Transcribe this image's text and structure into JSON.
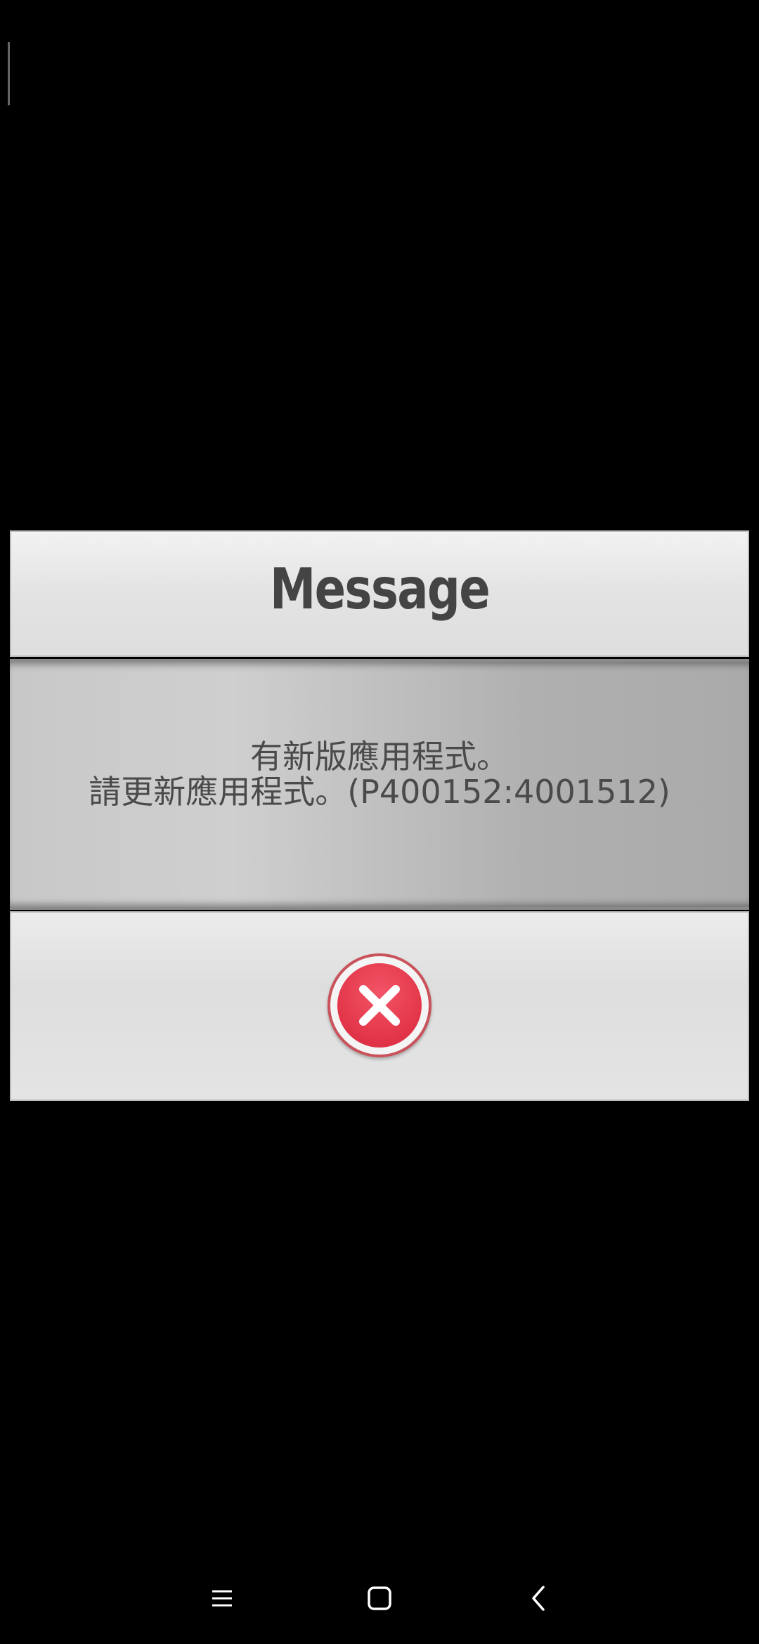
{
  "dialog": {
    "title": "Message",
    "message_lines": [
      "有新版應用程式。",
      "請更新應用程式。(P400152:4001512)"
    ],
    "close_icon": "close-icon"
  },
  "nav_bar": {
    "recents_icon": "recents-icon",
    "home_icon": "home-icon",
    "back_icon": "back-icon"
  },
  "colors": {
    "background": "#000000",
    "close_button": "#e23448",
    "text": "#4a4a4a"
  }
}
